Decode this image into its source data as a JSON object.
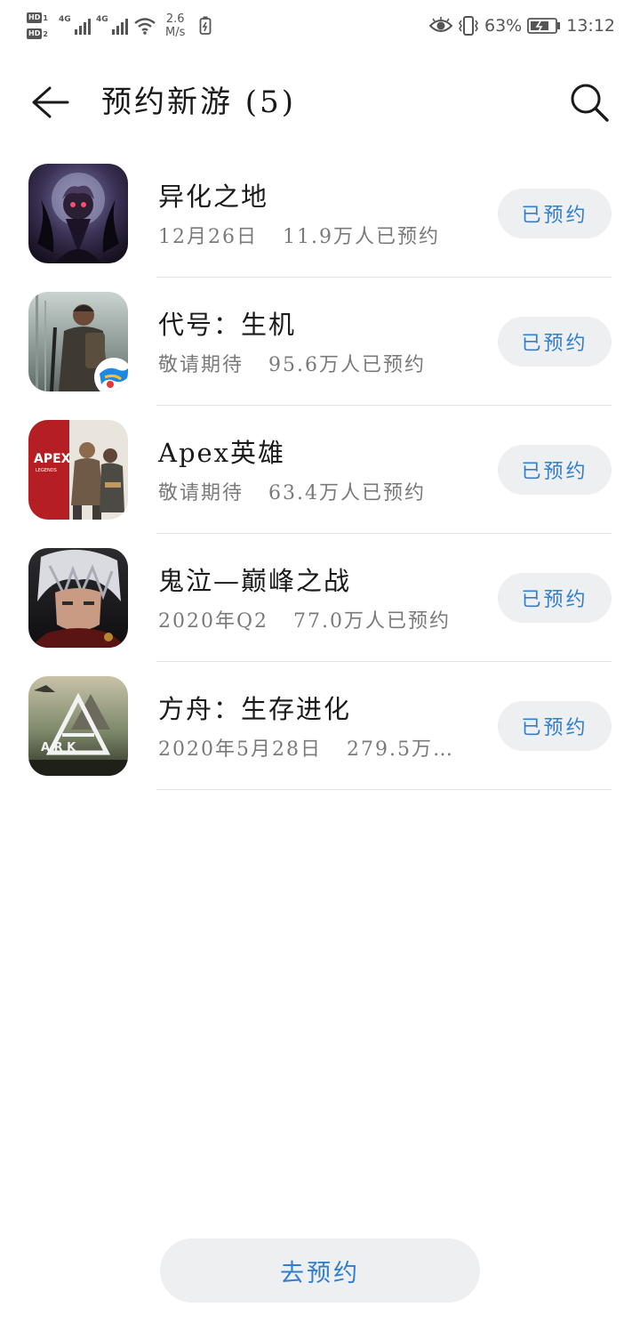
{
  "status_bar": {
    "hd1": "HD",
    "hd1_num": "1",
    "hd2": "HD",
    "hd2_num": "2",
    "sim1_tag": "4G",
    "sim2_tag": "4G",
    "net_speed_value": "2.6",
    "net_speed_unit": "M/s",
    "battery_percent": "63%",
    "time": "13:12",
    "icons": [
      "hd-icon",
      "signal-icon",
      "wifi-icon",
      "battery-saver-icon",
      "eye-comfort-icon",
      "vibrate-icon",
      "battery-icon"
    ]
  },
  "header": {
    "title": "预约新游 (5)",
    "back_icon": "back-arrow-icon",
    "search_icon": "search-icon"
  },
  "games": [
    {
      "name": "异化之地",
      "date": "12月26日",
      "reservations": "11.9万人已预约",
      "button": "已预约",
      "icon": "game-icon-yihua"
    },
    {
      "name": "代号：生机",
      "date": "敬请期待",
      "reservations": "95.6万人已预约",
      "button": "已预约",
      "icon": "game-icon-shengji"
    },
    {
      "name": "Apex英雄",
      "date": "敬请期待",
      "reservations": "63.4万人已预约",
      "button": "已预约",
      "icon": "game-icon-apex",
      "icon_text": "APEX",
      "icon_subtext": "LEGENDS"
    },
    {
      "name": "鬼泣—巅峰之战",
      "date": "2020年Q2",
      "reservations": "77.0万人已预约",
      "button": "已预约",
      "icon": "game-icon-devilmaycry"
    },
    {
      "name": "方舟：生存进化",
      "date": "2020年5月28日",
      "reservations": "279.5万…",
      "button": "已预约",
      "icon": "game-icon-ark",
      "icon_text": "A R K"
    }
  ],
  "footer": {
    "go_reserve_label": "去预约"
  },
  "colors": {
    "accent_blue": "#2f7fd0",
    "button_bg": "#eeeff1",
    "secondary_text": "#7a7a7a",
    "divider": "#e2e2e2"
  }
}
